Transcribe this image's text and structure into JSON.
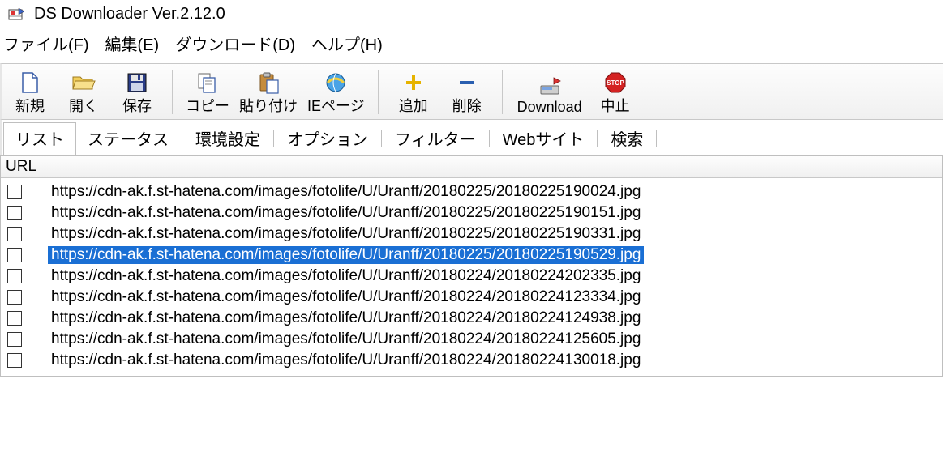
{
  "title": "DS Downloader Ver.2.12.0",
  "menu": {
    "file": "ファイル(F)",
    "edit": "編集(E)",
    "download": "ダウンロード(D)",
    "help": "ヘルプ(H)"
  },
  "toolbar": {
    "new": "新規",
    "open": "開く",
    "save": "保存",
    "copy": "コピー",
    "paste": "貼り付け",
    "iepage": "IEページ",
    "add": "追加",
    "delete": "削除",
    "download": "Download",
    "stop": "中止"
  },
  "tabs": {
    "list": "リスト",
    "status": "ステータス",
    "env": "環境設定",
    "options": "オプション",
    "filter": "フィルター",
    "website": "Webサイト",
    "search": "検索"
  },
  "listHeader": {
    "url": "URL"
  },
  "rows": [
    {
      "url": "https://cdn-ak.f.st-hatena.com/images/fotolife/U/Uranff/20180225/20180225190024.jpg",
      "selected": false
    },
    {
      "url": "https://cdn-ak.f.st-hatena.com/images/fotolife/U/Uranff/20180225/20180225190151.jpg",
      "selected": false
    },
    {
      "url": "https://cdn-ak.f.st-hatena.com/images/fotolife/U/Uranff/20180225/20180225190331.jpg",
      "selected": false
    },
    {
      "url": "https://cdn-ak.f.st-hatena.com/images/fotolife/U/Uranff/20180225/20180225190529.jpg",
      "selected": true
    },
    {
      "url": "https://cdn-ak.f.st-hatena.com/images/fotolife/U/Uranff/20180224/20180224202335.jpg",
      "selected": false
    },
    {
      "url": "https://cdn-ak.f.st-hatena.com/images/fotolife/U/Uranff/20180224/20180224123334.jpg",
      "selected": false
    },
    {
      "url": "https://cdn-ak.f.st-hatena.com/images/fotolife/U/Uranff/20180224/20180224124938.jpg",
      "selected": false
    },
    {
      "url": "https://cdn-ak.f.st-hatena.com/images/fotolife/U/Uranff/20180224/20180224125605.jpg",
      "selected": false
    },
    {
      "url": "https://cdn-ak.f.st-hatena.com/images/fotolife/U/Uranff/20180224/20180224130018.jpg",
      "selected": false
    }
  ]
}
